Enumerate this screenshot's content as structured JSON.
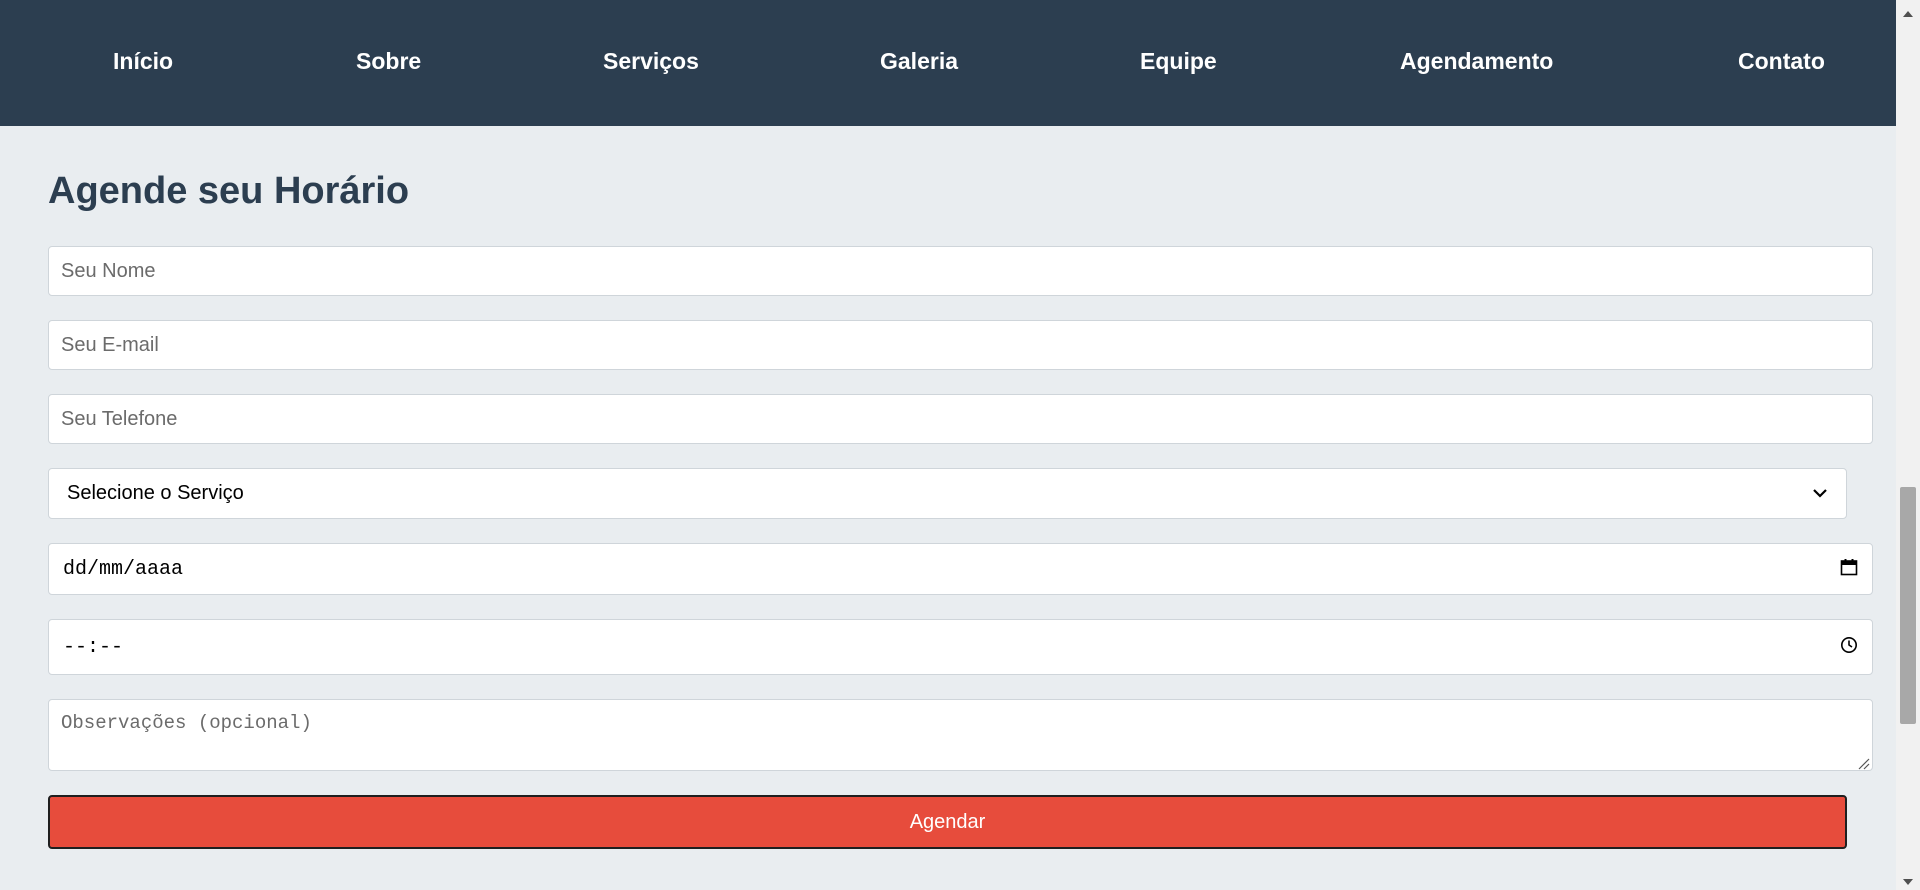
{
  "nav": {
    "items": [
      "Início",
      "Sobre",
      "Serviços",
      "Galeria",
      "Equipe",
      "Agendamento",
      "Contato"
    ]
  },
  "form": {
    "title": "Agende seu Horário",
    "name_placeholder": "Seu Nome",
    "email_placeholder": "Seu E-mail",
    "phone_placeholder": "Seu Telefone",
    "service_select": "Selecione o Serviço",
    "date_value": "dd/mm/aaaa",
    "time_value": "--:--",
    "notes_placeholder": "Observações (opcional)",
    "submit_label": "Agendar"
  },
  "colors": {
    "nav_bg": "#2c3e50",
    "page_bg": "#e9edf0",
    "title": "#2c3e50",
    "button": "#e74c3c"
  }
}
